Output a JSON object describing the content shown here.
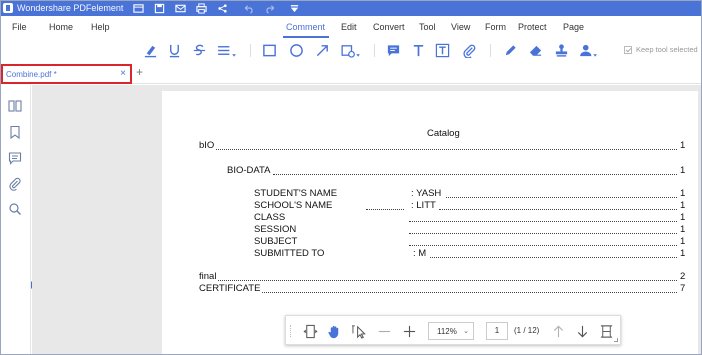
{
  "app": {
    "title": "Wondershare PDFelement"
  },
  "menu": {
    "items": [
      "File",
      "Home",
      "Help",
      "Comment",
      "Edit",
      "Convert",
      "Tool",
      "View",
      "Form",
      "Protect",
      "Page"
    ],
    "active": "Comment"
  },
  "ribbon": {
    "tools": [
      "highlight-icon",
      "underline-icon",
      "strikethrough-icon",
      "lines-icon",
      "rectangle-icon",
      "circle-icon",
      "arrow-icon",
      "shape-dropdown-icon",
      "note-icon",
      "text-icon",
      "textbox-icon",
      "attachment-icon",
      "pencil-icon",
      "eraser-icon",
      "stamp-icon",
      "signature-icon"
    ],
    "keep_tool_selected": "Keep tool selected"
  },
  "tabs": {
    "active_label": "Combine.pdf *",
    "close": "×",
    "add": "+"
  },
  "sidebar": {
    "icons": [
      "thumbnails-icon",
      "bookmark-icon",
      "comment-icon",
      "attachment-icon",
      "search-icon"
    ]
  },
  "document": {
    "title": "Catalog",
    "entries": [
      {
        "label": "bIO",
        "value": "",
        "page": "1"
      },
      {
        "label": "BIO-DATA",
        "value": "",
        "page": "1"
      },
      {
        "label": "STUDENT'S NAME",
        "value": ": YASH",
        "page": "1"
      },
      {
        "label": "SCHOOL'S NAME",
        "value": ": LITT",
        "page": "1"
      },
      {
        "label": "CLASS",
        "value": "",
        "page": "1"
      },
      {
        "label": "SESSION",
        "value": "",
        "page": "1"
      },
      {
        "label": "SUBJECT",
        "value": "",
        "page": "1"
      },
      {
        "label": "SUBMITTED TO",
        "value": ": M",
        "page": "1"
      },
      {
        "label": "final",
        "value": "",
        "page": "2"
      },
      {
        "label": "CERTIFICATE",
        "value": "",
        "page": "7"
      }
    ]
  },
  "bottom_toolbar": {
    "zoom": "112%",
    "zoom_caret": "⌄",
    "page_input": "1",
    "page_count": "(1 / 12)"
  }
}
